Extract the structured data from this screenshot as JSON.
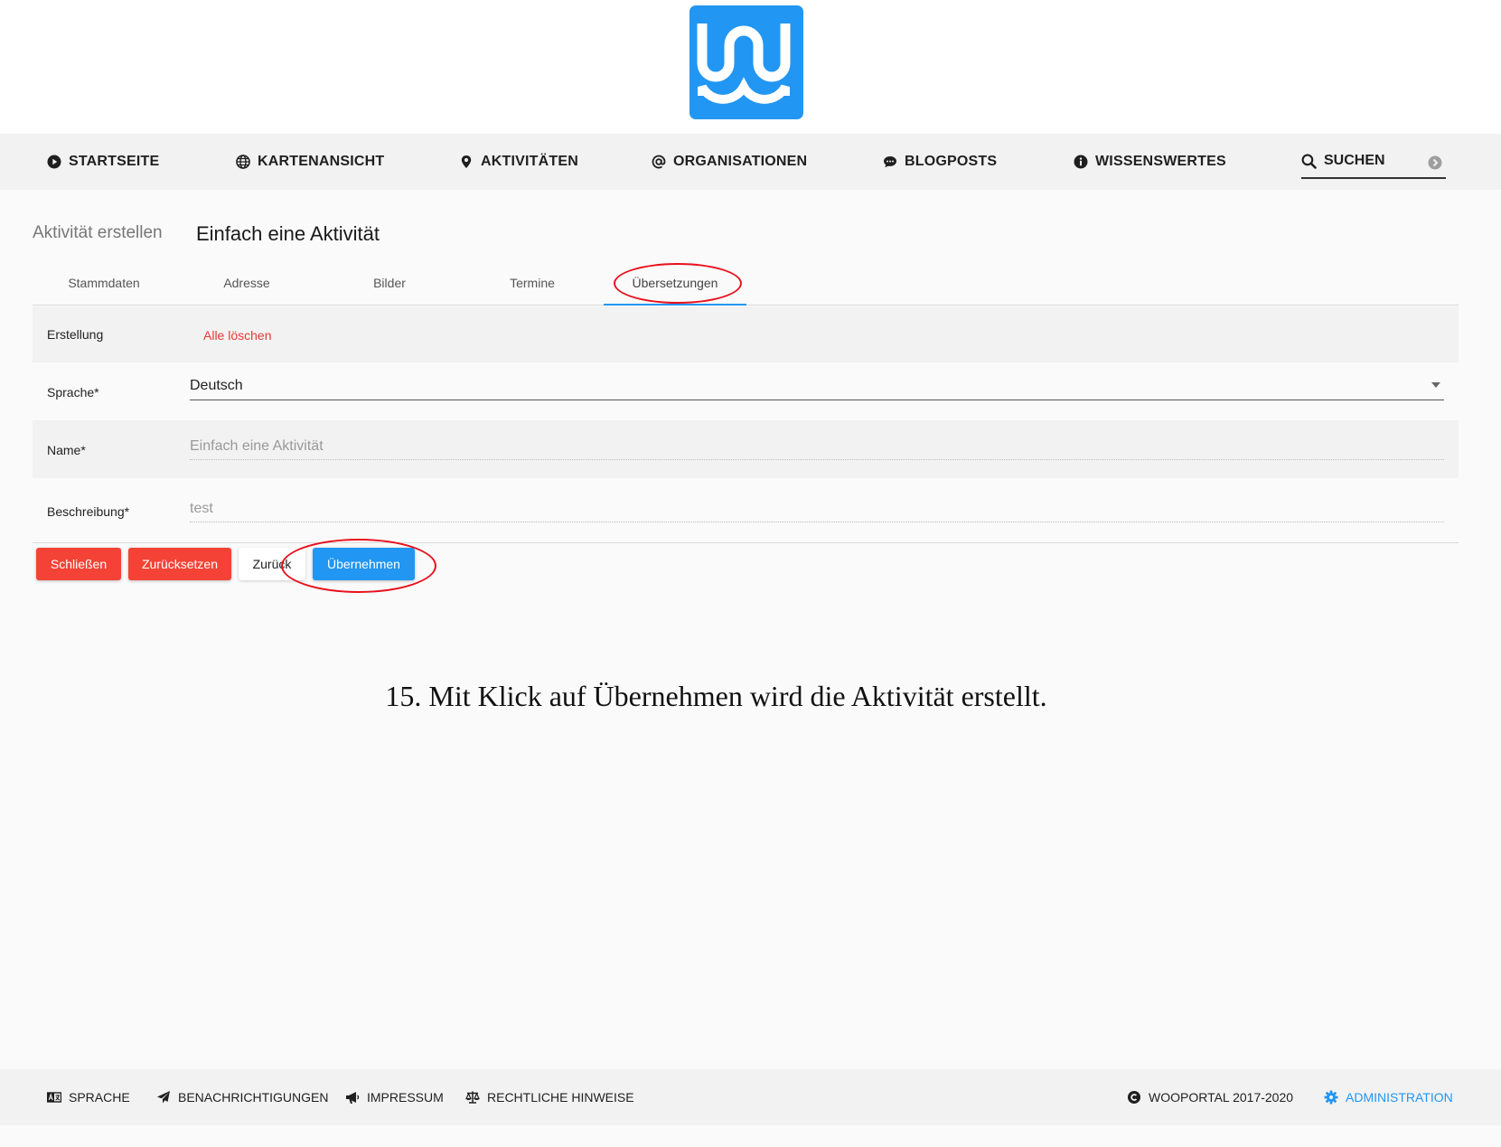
{
  "colors": {
    "brand": "#2196f3",
    "danger": "#f44336",
    "annotation": "#e8101c"
  },
  "nav": {
    "items": [
      {
        "label": "STARTSEITE",
        "icon": "play-circle-icon"
      },
      {
        "label": "KARTENANSICHT",
        "icon": "globe-icon"
      },
      {
        "label": "AKTIVITÄTEN",
        "icon": "map-pin-icon"
      },
      {
        "label": "ORGANISATIONEN",
        "icon": "at-icon"
      },
      {
        "label": "BLOGPOSTS",
        "icon": "chat-bubble-icon"
      },
      {
        "label": "WISSENSWERTES",
        "icon": "info-icon"
      }
    ],
    "search_placeholder": "SUCHEN"
  },
  "page": {
    "breadcrumb": "Aktivität erstellen",
    "title": "Einfach eine Aktivität"
  },
  "tabs": [
    "Stammdaten",
    "Adresse",
    "Bilder",
    "Termine",
    "Übersetzungen"
  ],
  "form": {
    "erstellung_label": "Erstellung",
    "delete_all": "Alle löschen",
    "language_label": "Sprache*",
    "language_value": "Deutsch",
    "name_label": "Name*",
    "name_value": "Einfach eine Aktivität",
    "description_label": "Beschreibung*",
    "description_value": "test"
  },
  "buttons": {
    "close": "Schließen",
    "reset": "Zurücksetzen",
    "back": "Zurück",
    "apply": "Übernehmen"
  },
  "caption": "15. Mit Klick auf Übernehmen wird die Aktivität erstellt.",
  "footer": {
    "language": "SPRACHE",
    "notifications": "BENACHRICHTIGUNGEN",
    "imprint": "IMPRESSUM",
    "legal": "RECHTLICHE HINWEISE",
    "copyright": "WOOPORTAL 2017-2020",
    "admin": "ADMINISTRATION"
  }
}
